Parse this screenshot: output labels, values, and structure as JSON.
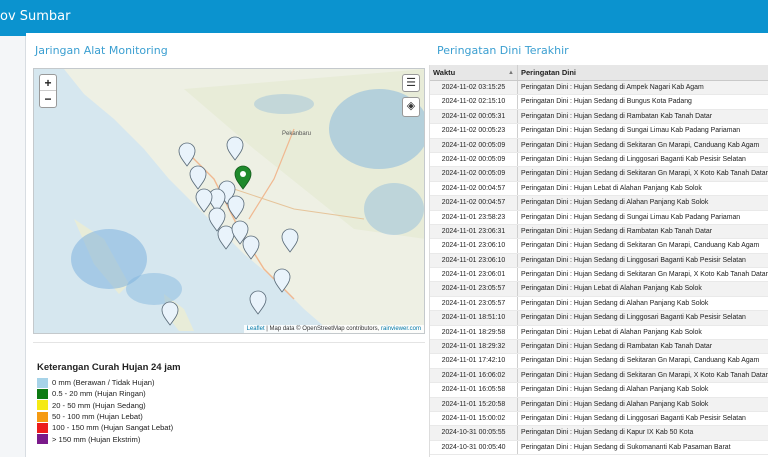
{
  "app": {
    "title": "ov Sumbar"
  },
  "monitoring": {
    "title": "Jaringan Alat Monitoring",
    "map": {
      "zoom_in": "+",
      "zoom_out": "−",
      "attribution_leaflet": "Leaflet",
      "attribution_text": " | Map data © OpenStreetMap contributors, ",
      "attribution_source": "rainviewer.com",
      "place_label": "Pekanbaru",
      "active_marker_color": "#1f8a2c",
      "marker_color": "#e9f3fb"
    }
  },
  "legend": {
    "title": "Keterangan Curah Hujan 24 jam",
    "items": [
      {
        "color": "#a7d3e8",
        "label": "0 mm (Berawan / Tidak Hujan)"
      },
      {
        "color": "#0d7a12",
        "label": "0.5 - 20 mm (Hujan Ringan)"
      },
      {
        "color": "#f5ea14",
        "label": "20 - 50 mm (Hujan Sedang)"
      },
      {
        "color": "#f59a12",
        "label": "50 - 100 mm (Hujan Lebat)"
      },
      {
        "color": "#ec1c1c",
        "label": "100 - 150 mm (Hujan Sangat Lebat)"
      },
      {
        "color": "#7a1a8a",
        "label": "> 150 mm (Hujan Ekstrim)"
      }
    ]
  },
  "warnings": {
    "title": "Peringatan Dini Terakhir",
    "columns": [
      "Waktu",
      "Peringatan Dini"
    ],
    "rows": [
      [
        "2024-11-02 03:15:25",
        "Peringatan Dini : Hujan Sedang di Ampek Nagari Kab Agam"
      ],
      [
        "2024-11-02 02:15:10",
        "Peringatan Dini : Hujan Sedang di Bungus Kota Padang"
      ],
      [
        "2024-11-02 00:05:31",
        "Peringatan Dini : Hujan Sedang di Rambatan Kab Tanah Datar"
      ],
      [
        "2024-11-02 00:05:23",
        "Peringatan Dini : Hujan Sedang di Sungai Limau Kab Padang Pariaman"
      ],
      [
        "2024-11-02 00:05:09",
        "Peringatan Dini : Hujan Sedang di Sekitaran Gn Marapi, Canduang Kab Agam"
      ],
      [
        "2024-11-02 00:05:09",
        "Peringatan Dini : Hujan Sedang di Linggosari Baganti Kab Pesisir Selatan"
      ],
      [
        "2024-11-02 00:05:09",
        "Peringatan Dini : Hujan Sedang di Sekitaran Gn Marapi, X Koto Kab Tanah Datar"
      ],
      [
        "2024-11-02 00:04:57",
        "Peringatan Dini : Hujan Lebat di Alahan Panjang Kab Solok"
      ],
      [
        "2024-11-02 00:04:57",
        "Peringatan Dini : Hujan Sedang di Alahan Panjang Kab Solok"
      ],
      [
        "2024-11-01 23:58:23",
        "Peringatan Dini : Hujan Sedang di Sungai Limau Kab Padang Pariaman"
      ],
      [
        "2024-11-01 23:06:31",
        "Peringatan Dini : Hujan Sedang di Rambatan Kab Tanah Datar"
      ],
      [
        "2024-11-01 23:06:10",
        "Peringatan Dini : Hujan Sedang di Sekitaran Gn Marapi, Canduang Kab Agam"
      ],
      [
        "2024-11-01 23:06:10",
        "Peringatan Dini : Hujan Sedang di Linggosari Baganti Kab Pesisir Selatan"
      ],
      [
        "2024-11-01 23:06:01",
        "Peringatan Dini : Hujan Sedang di Sekitaran Gn Marapi, X Koto Kab Tanah Datar"
      ],
      [
        "2024-11-01 23:05:57",
        "Peringatan Dini : Hujan Lebat di Alahan Panjang Kab Solok"
      ],
      [
        "2024-11-01 23:05:57",
        "Peringatan Dini : Hujan Sedang di Alahan Panjang Kab Solok"
      ],
      [
        "2024-11-01 18:51:10",
        "Peringatan Dini : Hujan Sedang di Linggosari Baganti Kab Pesisir Selatan"
      ],
      [
        "2024-11-01 18:29:58",
        "Peringatan Dini : Hujan Lebat di Alahan Panjang Kab Solok"
      ],
      [
        "2024-11-01 18:29:32",
        "Peringatan Dini : Hujan Sedang di Rambatan Kab Tanah Datar"
      ],
      [
        "2024-11-01 17:42:10",
        "Peringatan Dini : Hujan Sedang di Sekitaran Gn Marapi, Canduang Kab Agam"
      ],
      [
        "2024-11-01 16:06:02",
        "Peringatan Dini : Hujan Sedang di Sekitaran Gn Marapi, X Koto Kab Tanah Datar"
      ],
      [
        "2024-11-01 16:05:58",
        "Peringatan Dini : Hujan Sedang di Alahan Panjang Kab Solok"
      ],
      [
        "2024-11-01 15:20:58",
        "Peringatan Dini : Hujan Sedang di Alahan Panjang Kab Solok"
      ],
      [
        "2024-11-01 15:00:02",
        "Peringatan Dini : Hujan Sedang di Linggosari Baganti Kab Pesisir Selatan"
      ],
      [
        "2024-10-31 00:05:55",
        "Peringatan Dini : Hujan Sedang di Kapur IX Kab 50 Kota"
      ],
      [
        "2024-10-31 00:05:40",
        "Peringatan Dini : Hujan Sedang di Sukomananti Kab Pasaman Barat"
      ]
    ]
  }
}
